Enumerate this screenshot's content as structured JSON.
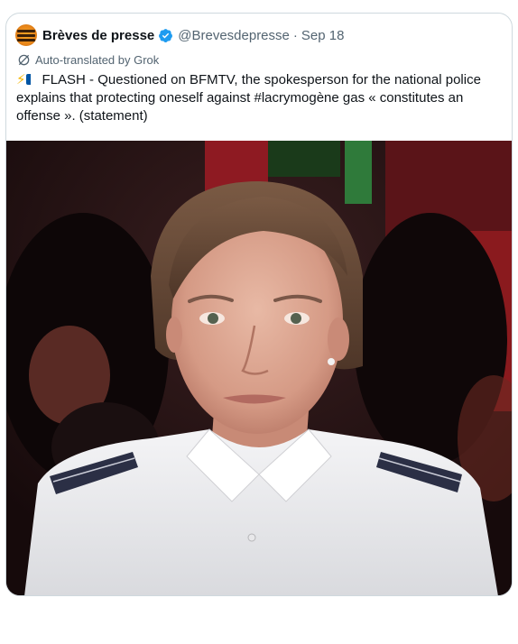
{
  "tweet": {
    "author_name": "Brèves de presse",
    "handle": "@Brevesdepresse",
    "separator": "·",
    "date": "Sep 18",
    "auto_translated_label": "Auto-translated by Grok",
    "text": "FLASH - Questioned on BFMTV, the spokesperson for the national police explains that protecting oneself against #lacrymogène gas « constitutes an offense ». (statement)",
    "emoji_bolt": "⚡",
    "verified_color": "#1d9bf0"
  },
  "media": {
    "description_icon": "photo-of-woman-in-police-uniform",
    "background_color": "#2a1516"
  }
}
